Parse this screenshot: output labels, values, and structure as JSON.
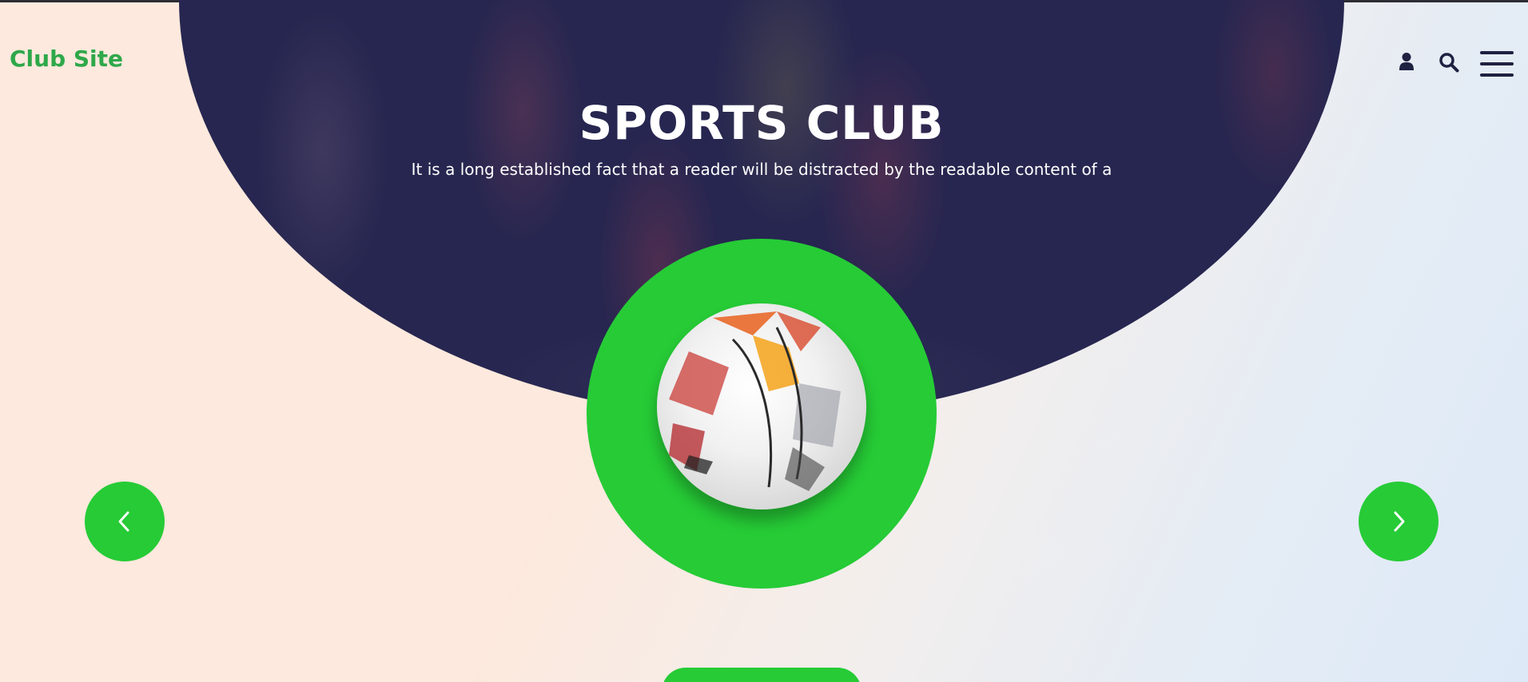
{
  "brand": {
    "name": "Club Site"
  },
  "header": {
    "icons": [
      "user-icon",
      "search-icon",
      "hamburger-menu-icon"
    ]
  },
  "hero": {
    "title": "SPORTS CLUB",
    "subtitle": "It is a long established fact that a reader will be distracted by the readable content of a"
  },
  "slider": {
    "prev_icon": "chevron-left-icon",
    "next_icon": "chevron-right-icon"
  },
  "colors": {
    "accent_green": "#26cb36",
    "brand_green": "#2ea84a",
    "hero_navy": "#262650",
    "icon_dark": "#1f2141"
  }
}
